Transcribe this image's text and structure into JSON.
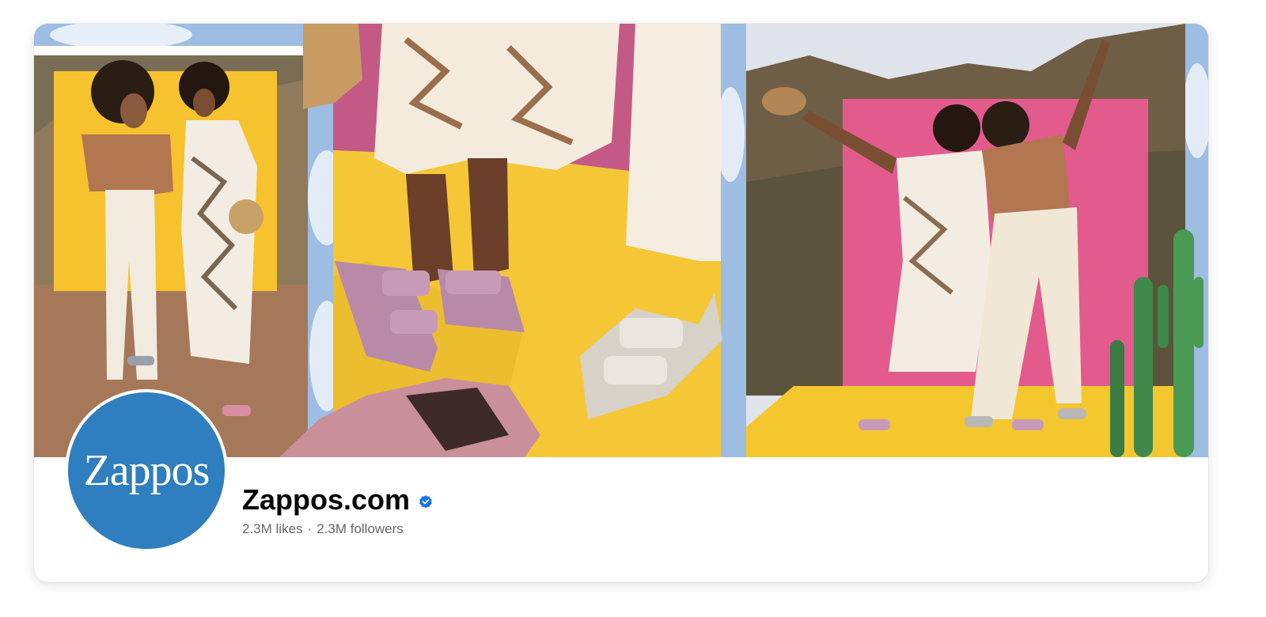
{
  "page": {
    "name": "Zappos.com",
    "verified": true,
    "likes": "2.3M likes",
    "separator": "·",
    "followers": "2.3M followers"
  },
  "profile": {
    "logo_text": "Zappos",
    "logo_color": "#2f7ebf"
  },
  "icons": {
    "verified_badge": "verified-badge-icon"
  },
  "colors": {
    "verified": "#1b74e4",
    "name": "#050505",
    "secondary_text": "#65676b"
  }
}
